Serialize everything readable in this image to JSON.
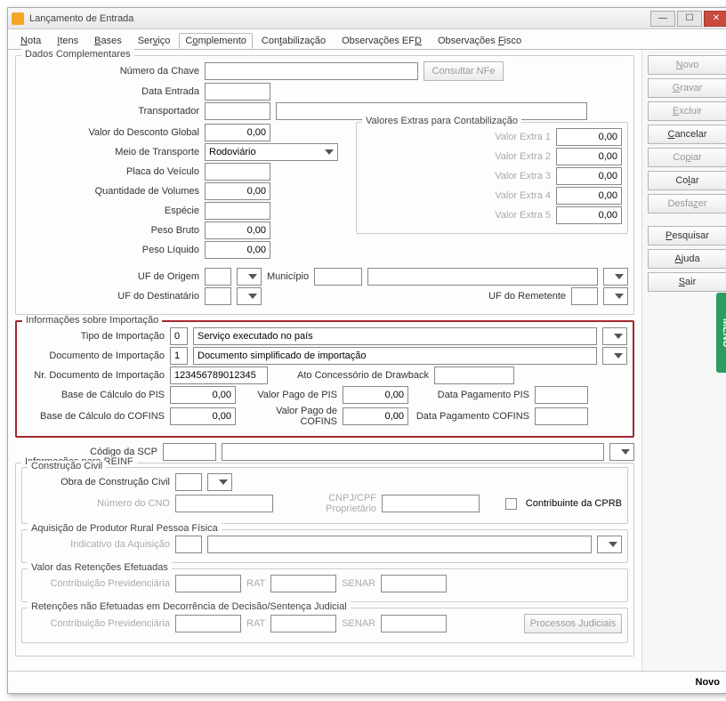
{
  "title": "Lançamento de Entrada",
  "tabs": [
    "Nota",
    "Itens",
    "Bases",
    "Serviço",
    "Complemento",
    "Contabilização",
    "Observações EFD",
    "Observações Fisco"
  ],
  "active_tab": "Complemento",
  "sidebar": {
    "novo": "Novo",
    "gravar": "Gravar",
    "excluir": "Excluir",
    "cancelar": "Cancelar",
    "copiar": "Copiar",
    "colar": "Colar",
    "desfazer": "Desfazer",
    "pesquisar": "Pesquisar",
    "ajuda": "Ajuda",
    "sair": "Sair"
  },
  "menu_handle": "MENU",
  "status": "Novo",
  "label": {
    "dados_comp": "Dados Complementares",
    "num_chave": "Número da Chave",
    "consultar_nfe": "Consultar NFe",
    "data_entrada": "Data Entrada",
    "transportador": "Transportador",
    "valor_desc_global": "Valor do Desconto Global",
    "meio_transporte": "Meio de Transporte",
    "placa": "Placa do Veículo",
    "qtd_vol": "Quantidade de Volumes",
    "especie": "Espécie",
    "peso_bruto": "Peso Bruto",
    "peso_liquido": "Peso Líquido",
    "valores_extras": "Valores Extras para Contabilização",
    "ve1": "Valor Extra 1",
    "ve2": "Valor Extra 2",
    "ve3": "Valor Extra 3",
    "ve4": "Valor Extra 4",
    "ve5": "Valor Extra 5",
    "uf_origem": "UF de Origem",
    "municipio": "Município",
    "uf_dest": "UF do Destinatário",
    "uf_rem": "UF do Remetente",
    "info_import": "Informações sobre Importação",
    "tipo_import": "Tipo de Importação",
    "doc_import": "Documento de Importação",
    "nr_doc_import": "Nr. Documento de Importação",
    "ato_draw": "Ato Concessório de Drawback",
    "base_pis": "Base de Cálculo do PIS",
    "vp_pis": "Valor Pago de PIS",
    "dp_pis": "Data Pagamento PIS",
    "base_cofins": "Base de Cálculo do COFINS",
    "vp_cofins": "Valor Pago de COFINS",
    "dp_cofins": "Data Pagamento COFINS",
    "codigo_scp": "Código da SCP",
    "info_reinf": "Informações para REINF",
    "constr_civil": "Construção Civil",
    "obra": "Obra de Construção Civil",
    "num_cno": "Número do CNO",
    "cnpj": "CNPJ/CPF Proprietário",
    "contrib_cprb": "Contribuinte da CPRB",
    "aquis_prod": "Aquisição de Produtor Rural Pessoa Física",
    "indic_aquis": "Indicativo da Aquisição",
    "val_ret": "Valor das Retenções Efetuadas",
    "contrib_prev": "Contribuição Previdenciária",
    "rat": "RAT",
    "senar": "SENAR",
    "ret_nao": "Retenções não Efetuadas em Decorrência de Decisão/Sentença Judicial",
    "proc_jud": "Processos Judiciais"
  },
  "value": {
    "num_chave": "",
    "data_entrada": "",
    "transportador": "",
    "transportador_desc": "",
    "valor_desc_global": "0,00",
    "meio_transporte": "Rodoviário",
    "placa": "",
    "qtd_vol": "0,00",
    "especie": "",
    "peso_bruto": "0,00",
    "peso_liquido": "0,00",
    "ve1": "0,00",
    "ve2": "0,00",
    "ve3": "0,00",
    "ve4": "0,00",
    "ve5": "0,00",
    "uf_origem": "",
    "municipio": "",
    "municipio_desc": "",
    "uf_dest": "",
    "uf_rem": "",
    "tipo_import": "0",
    "tipo_import_desc": "Serviço executado no país",
    "doc_import": "1",
    "doc_import_desc": "Documento simplificado de importação",
    "nr_doc_import": "123456789012345",
    "ato_draw": "",
    "base_pis": "0,00",
    "vp_pis": "0,00",
    "dp_pis": "",
    "base_cofins": "0,00",
    "vp_cofins": "0,00",
    "dp_cofins": "",
    "codigo_scp": "",
    "codigo_scp_desc": "",
    "obra": "",
    "num_cno": "",
    "cnpj": "",
    "indic_aquis": "",
    "contrib_prev1": "",
    "rat1": "",
    "senar1": "",
    "contrib_prev2": "",
    "rat2": "",
    "senar2": ""
  }
}
